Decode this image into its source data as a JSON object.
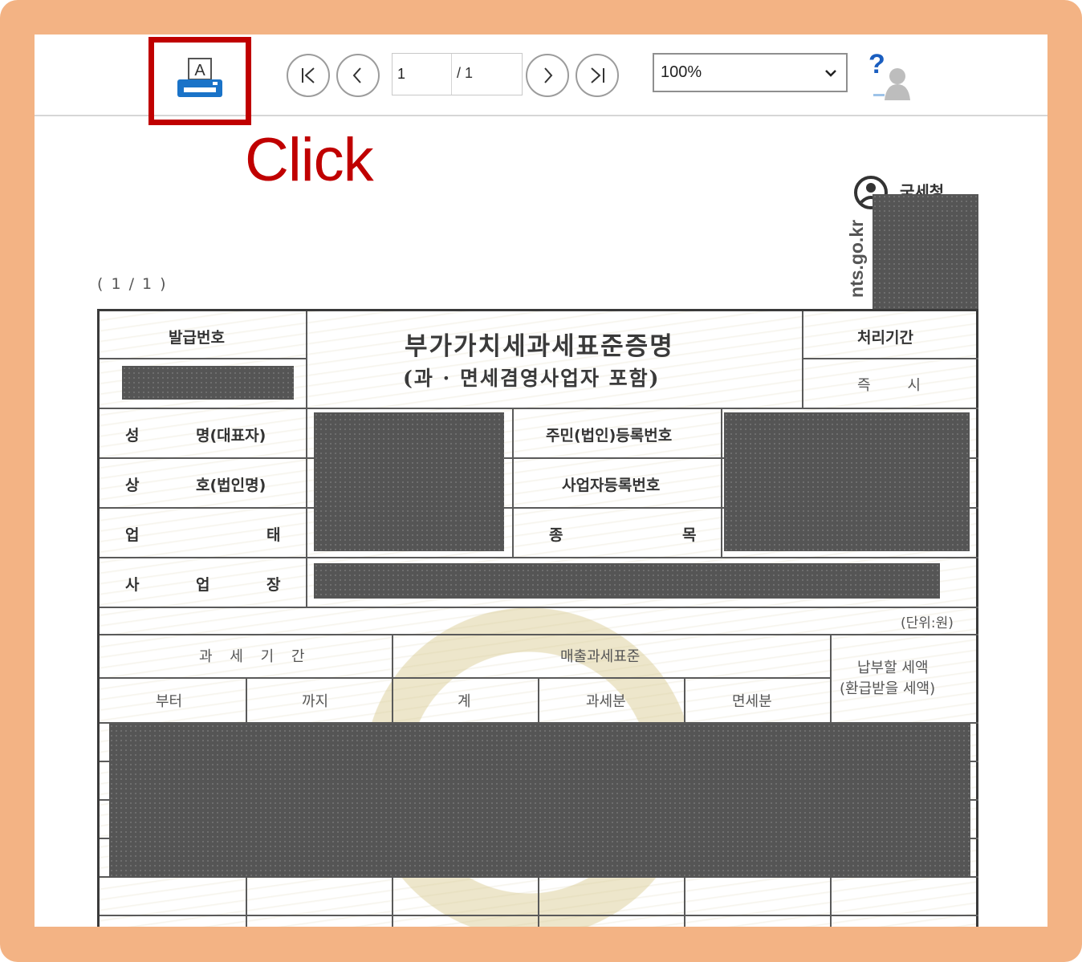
{
  "toolbar": {
    "print_icon_letter": "A",
    "page_current": "1",
    "page_total": "/ 1",
    "zoom": "100%",
    "help_symbol": "?"
  },
  "callout": {
    "text": "Click"
  },
  "document": {
    "page_count": "( 1 / 1 )",
    "agency": "국세청",
    "url": "nts.go.kr",
    "title": "부가가치세과세표준증명",
    "subtitle": "(과 · 면세겸영사업자 포함)",
    "issue_no_label": "발급번호",
    "processing_period_label": "처리기간",
    "processing_period_value": "즉        시",
    "row_labels": {
      "name": [
        "성",
        "명(대표자)"
      ],
      "trade_name": [
        "상",
        "호(법인명)"
      ],
      "business_type": [
        "업",
        "태"
      ],
      "workplace": [
        "사",
        "업",
        "장"
      ]
    },
    "resident_no_label": "주민(법인)등록번호",
    "business_reg_label": "사업자등록번호",
    "item_label": [
      "종",
      "목"
    ],
    "unit_note": "(단위:원)",
    "table_headers": {
      "tax_period": "과 세 기 간",
      "sales_base": "매출과세표준",
      "tax_payable": "납부할 세액",
      "tax_refund": "(환급받을 세액)",
      "from": "부터",
      "to": "까지",
      "total": "계",
      "taxable": "과세분",
      "exempt": "면세분"
    }
  }
}
